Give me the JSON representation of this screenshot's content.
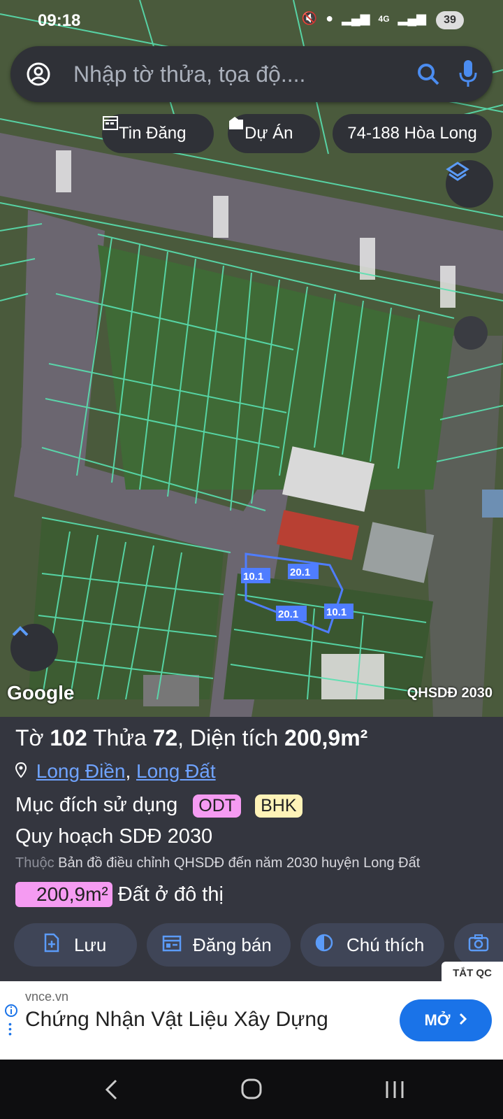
{
  "status_bar": {
    "time": "09:18",
    "network": "4G",
    "battery": "39"
  },
  "search": {
    "placeholder": "Nhập tờ thửa, tọa độ...."
  },
  "filters": [
    {
      "label": "Tin Đăng",
      "icon": "calendar-icon"
    },
    {
      "label": "Dự Án",
      "icon": "building-icon"
    },
    {
      "label": "74-188 Hòa Long"
    }
  ],
  "map": {
    "dimensions": [
      "10.1",
      "20.1",
      "20.1",
      "10.1"
    ],
    "attribution": "Google",
    "layer_label": "QHSDĐ 2030"
  },
  "parcel": {
    "sheet_prefix": "Tờ ",
    "sheet": "102",
    "plot_prefix": " Thửa ",
    "plot": "72",
    "area_prefix": ", Diện tích ",
    "area": "200,9m²",
    "location_district": "Long Điền",
    "location_sep": ", ",
    "location_ward": "Long Đất",
    "purpose_label": "Mục đích sử dụng",
    "purpose_tags": [
      {
        "code": "ODT",
        "color": "#f59bf2"
      },
      {
        "code": "BHK",
        "color": "#fff3b8"
      }
    ],
    "plan_title": "Quy hoạch SDĐ 2030",
    "belongs_prefix": "Thuộc",
    "belongs_text": "Bản đồ điều chỉnh QHSDĐ đến năm 2030 huyện Long Đất",
    "area_badge": "200,9m²",
    "area_badge_color": "#f59bf2",
    "land_type": "Đất ở đô thị"
  },
  "actions": [
    {
      "label": "Lưu",
      "icon": "save-icon"
    },
    {
      "label": "Đăng bán",
      "icon": "post-icon"
    },
    {
      "label": "Chú thích",
      "icon": "legend-icon"
    }
  ],
  "ad": {
    "close_label": "TẮT QC",
    "domain": "vnce.vn",
    "title": "Chứng Nhận Vật Liệu Xây Dựng",
    "button": "MỞ",
    "button_color": "#1a73e8"
  },
  "colors": {
    "parcel_lines": "#59e0b0",
    "highlight": "#4f7dff",
    "panel_bg": "#34363f"
  }
}
